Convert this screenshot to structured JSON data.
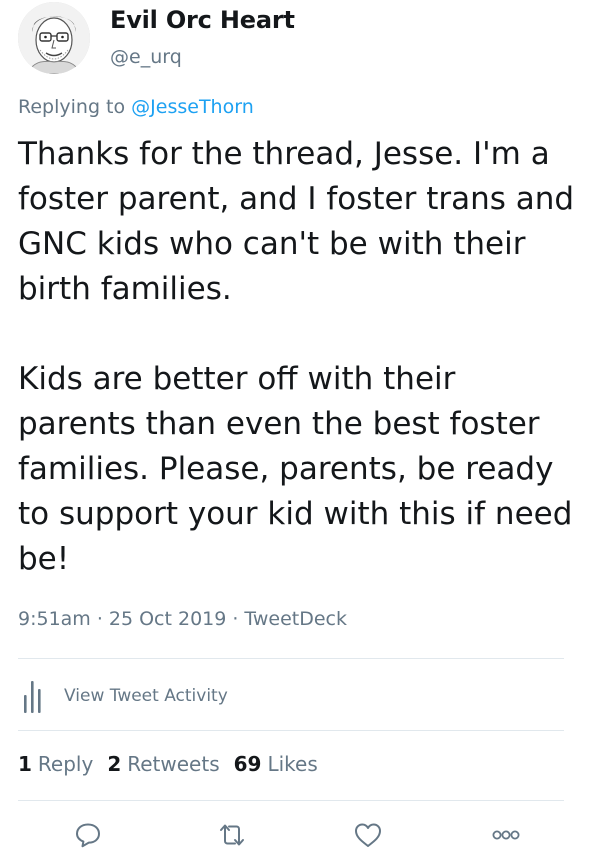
{
  "author": {
    "display_name": "Evil Orc Heart",
    "handle": "@e_urq",
    "avatar_icon": "cartoon-face-avatar"
  },
  "reply": {
    "prefix": "Replying to",
    "target": "@JesseThorn"
  },
  "tweet": {
    "paragraphs": [
      "Thanks for the thread, Jesse. I'm a foster parent, and I foster trans and GNC kids who can't be with their birth families.",
      "Kids are better off with their parents than even the best foster families. Please, parents, be ready to support your kid with this if need be!"
    ]
  },
  "meta": {
    "time": "9:51am",
    "separator": "·",
    "date": "25 Oct 2019",
    "source": "TweetDeck"
  },
  "activity": {
    "label": "View Tweet Activity",
    "icon": "bar-chart-icon"
  },
  "stats": {
    "replies_count": "1",
    "replies_label": "Reply",
    "retweets_count": "2",
    "retweets_label": "Retweets",
    "likes_count": "69",
    "likes_label": "Likes"
  },
  "actions": [
    {
      "name": "reply",
      "icon": "speech-bubble-icon"
    },
    {
      "name": "retweet",
      "icon": "retweet-arrows-icon"
    },
    {
      "name": "like",
      "icon": "heart-icon"
    },
    {
      "name": "more",
      "icon": "more-dots-icon"
    }
  ],
  "colors": {
    "text": "#14171a",
    "secondary": "#657786",
    "link": "#1da1f2",
    "divider": "#e1e8ed"
  }
}
